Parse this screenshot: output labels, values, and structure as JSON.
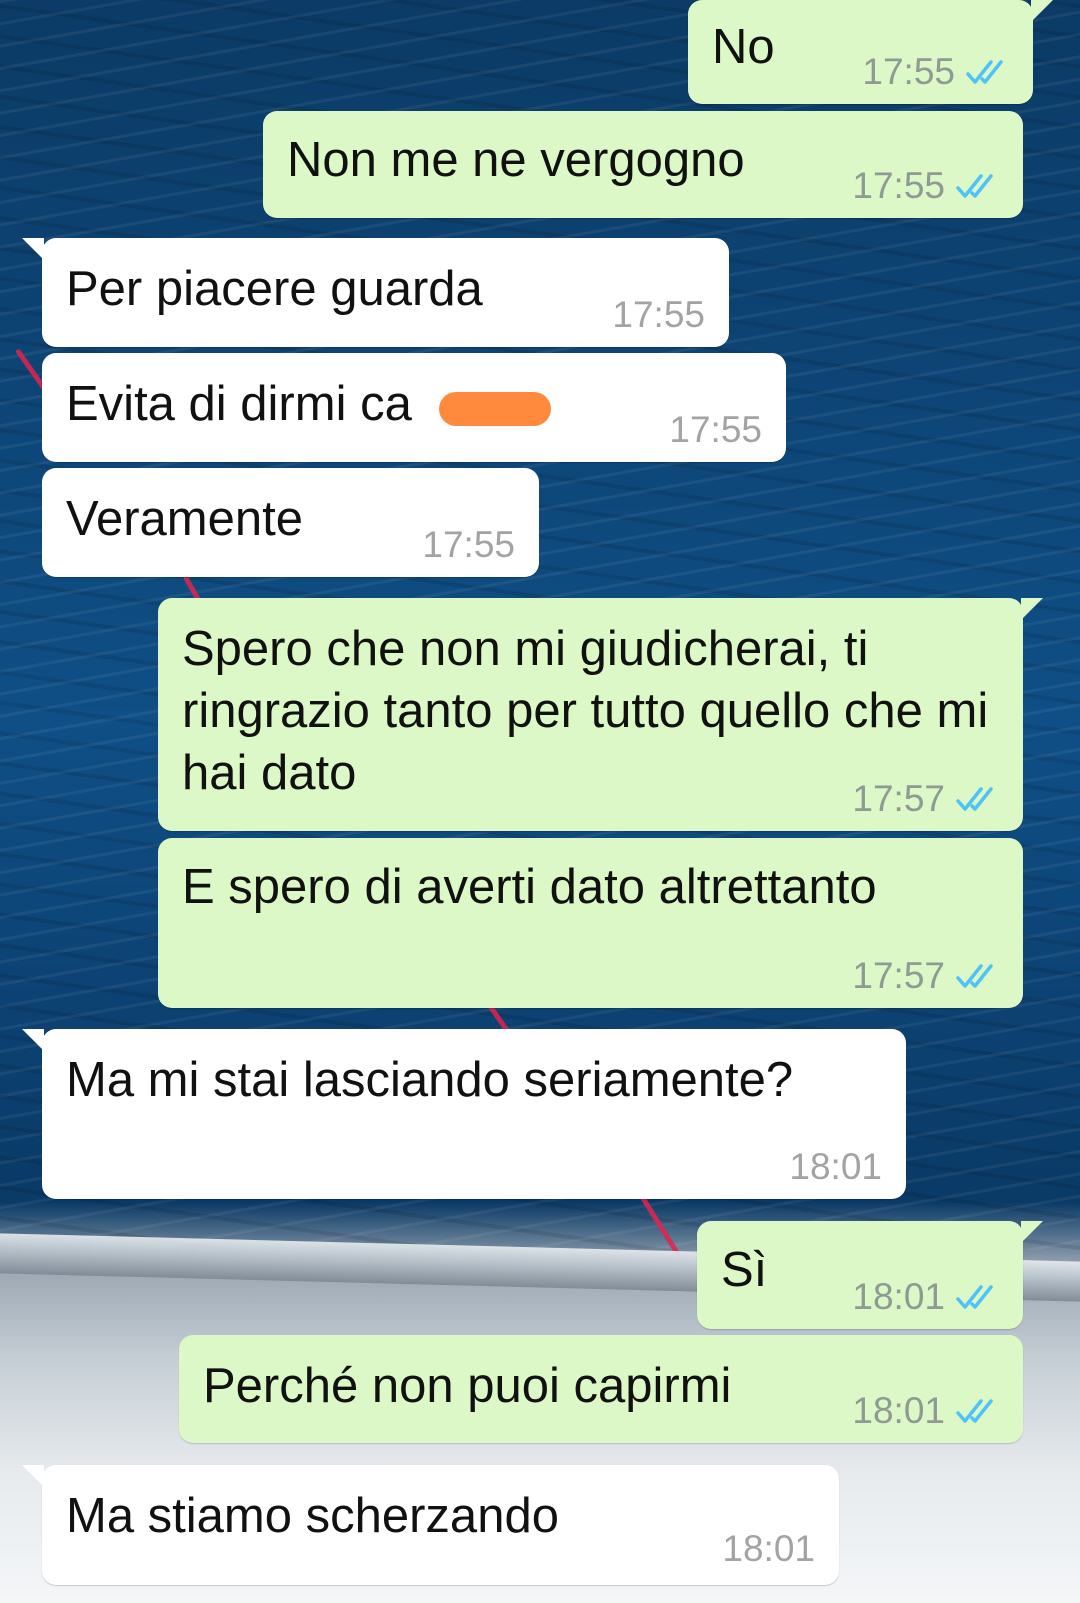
{
  "messages": [
    {
      "dir": "out",
      "text": "No",
      "time": "17:55",
      "read": true
    },
    {
      "dir": "out",
      "text": "Non me ne vergogno",
      "time": "17:55",
      "read": true
    },
    {
      "dir": "in",
      "text": "Per piacere guarda",
      "time": "17:55"
    },
    {
      "dir": "in",
      "text": "Evita di dirmi ca        e",
      "time": "17:55"
    },
    {
      "dir": "in",
      "text": "Veramente",
      "time": "17:55"
    },
    {
      "dir": "out",
      "text": "Spero che non mi giudicherai, ti ringrazio tanto per tutto quello che mi hai dato",
      "time": "17:57",
      "read": true
    },
    {
      "dir": "out",
      "text": "E spero di averti dato altrettanto",
      "time": "17:57",
      "read": true
    },
    {
      "dir": "in",
      "text": "Ma mi stai lasciando seriamente?",
      "time": "18:01"
    },
    {
      "dir": "out",
      "text": "Sì",
      "time": "18:01",
      "read": true
    },
    {
      "dir": "out",
      "text": "Perché non puoi capirmi",
      "time": "18:01",
      "read": true
    },
    {
      "dir": "in",
      "text": "Ma stiamo scherzando",
      "time": "18:01"
    }
  ],
  "colors": {
    "outgoing_bubble": "#dcf8c6",
    "incoming_bubble": "#ffffff",
    "read_ticks": "#4fc3f7",
    "redaction": "#ff8a3d"
  },
  "icons": {
    "read_receipt": "double-check-icon"
  }
}
